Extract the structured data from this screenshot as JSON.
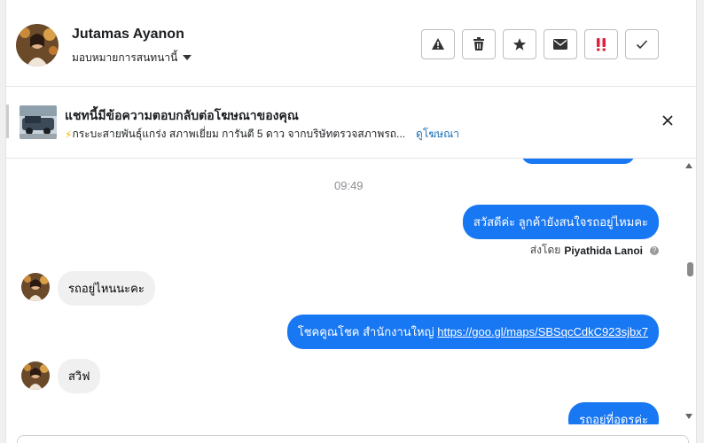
{
  "header": {
    "contact_name": "Jutamas Ayanon",
    "assign_label": "มอบหมายการสนทนานี้",
    "actions": [
      {
        "name": "report-spam",
        "icon": "warning-icon"
      },
      {
        "name": "delete",
        "icon": "trash-icon"
      },
      {
        "name": "star",
        "icon": "star-icon"
      },
      {
        "name": "mark-unread",
        "icon": "envelope-icon"
      },
      {
        "name": "follow-up",
        "icon": "exclamation-icon"
      },
      {
        "name": "mark-done",
        "icon": "check-icon"
      }
    ]
  },
  "ad_banner": {
    "title": "แชทนี้มีข้อความตอบกลับต่อโฆษณาของคุณ",
    "emoji": "⚡",
    "description": "กระบะสายพันธุ์แกร่ง สภาพเยี่ยม การันตี 5 ดาว จากบริษัทตรวจสภาพรถ...",
    "link_label": "ดูโฆษณา"
  },
  "chat": {
    "timestamp": "09:49",
    "messages": [
      {
        "direction": "out",
        "text": "สวัสดีค่ะ ลูกค้ายังสนใจรถอยู่ไหมคะ"
      },
      {
        "direction": "in",
        "text": "รถอยู่ไหนนะคะ"
      },
      {
        "direction": "out",
        "text_prefix": "โชคคูณโชค สำนักงานใหญ่ ",
        "link": "https://goo.gl/maps/SBSqcCdkC923sjbx7"
      },
      {
        "direction": "in",
        "text": "สวิฟ"
      },
      {
        "direction": "out",
        "text": "รถอยู่ที่อุดรค่ะ"
      }
    ],
    "sent_by_prefix": "ส่งโดย",
    "sent_by_name": "Piyathida Lanoi"
  },
  "colors": {
    "outgoing_bubble": "#1877f2",
    "incoming_bubble": "#f0f0f0",
    "follow_up_icon": "#e41e3f",
    "ad_link": "#1a6fb5"
  }
}
